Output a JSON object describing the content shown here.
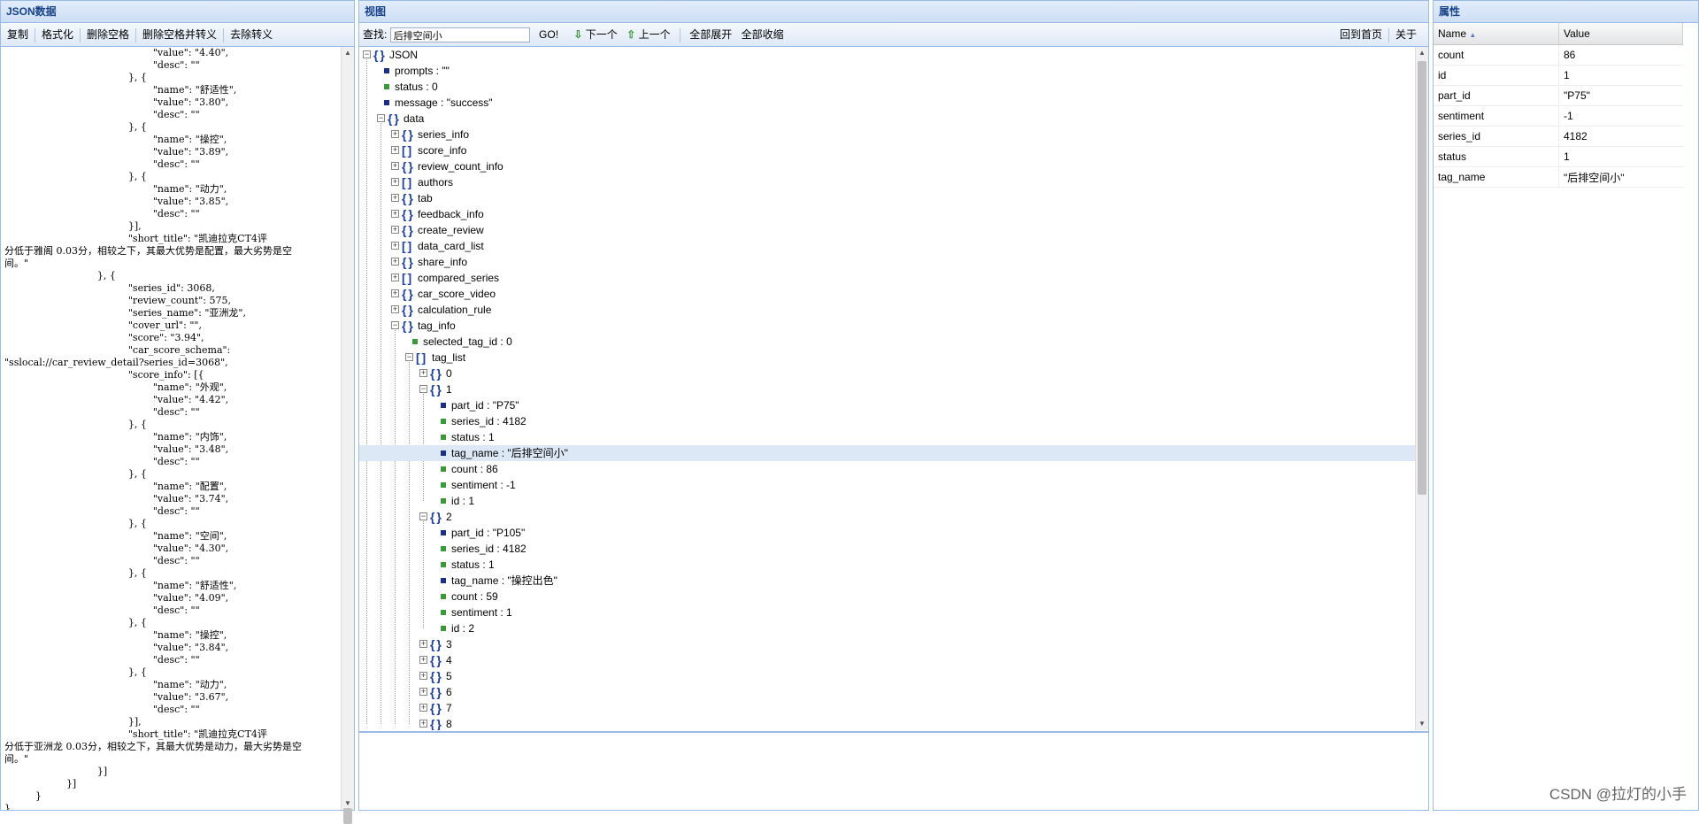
{
  "left": {
    "title": "JSON数据",
    "toolbar": [
      "复制",
      "格式化",
      "删除空格",
      "删除空格并转义",
      "去除转义"
    ],
    "lines": [
      "                                                \"value\": \"4.40\",",
      "                                                \"desc\": \"\"",
      "                                        }, {",
      "                                                \"name\": \"舒适性\",",
      "                                                \"value\": \"3.80\",",
      "                                                \"desc\": \"\"",
      "                                        }, {",
      "                                                \"name\": \"操控\",",
      "                                                \"value\": \"3.89\",",
      "                                                \"desc\": \"\"",
      "                                        }, {",
      "                                                \"name\": \"动力\",",
      "                                                \"value\": \"3.85\",",
      "                                                \"desc\": \"\"",
      "                                        }],",
      "                                        \"short_title\": \"凯迪拉克CT4评",
      "分低于雅阁 0.03分，相较之下，其最大优势是配置，最大劣势是空",
      "间。\"",
      "                              }, {",
      "                                        \"series_id\": 3068,",
      "                                        \"review_count\": 575,",
      "                                        \"series_name\": \"亚洲龙\",",
      "                                        \"cover_url\": \"\",",
      "                                        \"score\": \"3.94\",",
      "                                        \"car_score_schema\":",
      "\"sslocal://car_review_detail?series_id=3068\",",
      "                                        \"score_info\": [{",
      "                                                \"name\": \"外观\",",
      "                                                \"value\": \"4.42\",",
      "                                                \"desc\": \"\"",
      "                                        }, {",
      "                                                \"name\": \"内饰\",",
      "                                                \"value\": \"3.48\",",
      "                                                \"desc\": \"\"",
      "                                        }, {",
      "                                                \"name\": \"配置\",",
      "                                                \"value\": \"3.74\",",
      "                                                \"desc\": \"\"",
      "                                        }, {",
      "                                                \"name\": \"空间\",",
      "                                                \"value\": \"4.30\",",
      "                                                \"desc\": \"\"",
      "                                        }, {",
      "                                                \"name\": \"舒适性\",",
      "                                                \"value\": \"4.09\",",
      "                                                \"desc\": \"\"",
      "                                        }, {",
      "                                                \"name\": \"操控\",",
      "                                                \"value\": \"3.84\",",
      "                                                \"desc\": \"\"",
      "                                        }, {",
      "                                                \"name\": \"动力\",",
      "                                                \"value\": \"3.67\",",
      "                                                \"desc\": \"\"",
      "                                        }],",
      "                                        \"short_title\": \"凯迪拉克CT4评",
      "分低于亚洲龙 0.03分，相较之下，其最大优势是动力，最大劣势是空",
      "间。\"",
      "                              }]",
      "                    }]",
      "          }",
      "}"
    ]
  },
  "view": {
    "title": "视图",
    "search_label": "查找:",
    "search_value": "后排空间小",
    "go": "GO!",
    "next": "下一个",
    "prev": "上一个",
    "expand_all": "全部展开",
    "collapse_all": "全部收缩",
    "home": "回到首页",
    "about": "关于",
    "tree": [
      {
        "level": 0,
        "type": "obj",
        "label": "JSON",
        "state": "open"
      },
      {
        "level": 1,
        "type": "leaf",
        "label": "prompts : \"\"",
        "color": "b"
      },
      {
        "level": 1,
        "type": "leaf",
        "label": "status : 0",
        "color": "g"
      },
      {
        "level": 1,
        "type": "leaf",
        "label": "message : \"success\"",
        "color": "b"
      },
      {
        "level": 1,
        "type": "obj",
        "label": "data",
        "state": "open"
      },
      {
        "level": 2,
        "type": "obj",
        "label": "series_info",
        "state": "closed"
      },
      {
        "level": 2,
        "type": "arr",
        "label": "score_info",
        "state": "closed"
      },
      {
        "level": 2,
        "type": "obj",
        "label": "review_count_info",
        "state": "closed"
      },
      {
        "level": 2,
        "type": "arr",
        "label": "authors",
        "state": "closed"
      },
      {
        "level": 2,
        "type": "obj",
        "label": "tab",
        "state": "closed"
      },
      {
        "level": 2,
        "type": "obj",
        "label": "feedback_info",
        "state": "closed"
      },
      {
        "level": 2,
        "type": "obj",
        "label": "create_review",
        "state": "closed"
      },
      {
        "level": 2,
        "type": "arr",
        "label": "data_card_list",
        "state": "closed"
      },
      {
        "level": 2,
        "type": "obj",
        "label": "share_info",
        "state": "closed"
      },
      {
        "level": 2,
        "type": "arr",
        "label": "compared_series",
        "state": "closed"
      },
      {
        "level": 2,
        "type": "obj",
        "label": "car_score_video",
        "state": "closed"
      },
      {
        "level": 2,
        "type": "obj",
        "label": "calculation_rule",
        "state": "closed"
      },
      {
        "level": 2,
        "type": "obj",
        "label": "tag_info",
        "state": "open"
      },
      {
        "level": 3,
        "type": "leaf",
        "label": "selected_tag_id : 0",
        "color": "g"
      },
      {
        "level": 3,
        "type": "arr",
        "label": "tag_list",
        "state": "open"
      },
      {
        "level": 4,
        "type": "obj",
        "label": "0",
        "state": "closed"
      },
      {
        "level": 4,
        "type": "obj",
        "label": "1",
        "state": "open"
      },
      {
        "level": 5,
        "type": "leaf",
        "label": "part_id : \"P75\"",
        "color": "b"
      },
      {
        "level": 5,
        "type": "leaf",
        "label": "series_id : 4182",
        "color": "g"
      },
      {
        "level": 5,
        "type": "leaf",
        "label": "status : 1",
        "color": "g"
      },
      {
        "level": 5,
        "type": "leaf",
        "label": "tag_name : \"后排空间小\"",
        "color": "b",
        "selected": true
      },
      {
        "level": 5,
        "type": "leaf",
        "label": "count : 86",
        "color": "g"
      },
      {
        "level": 5,
        "type": "leaf",
        "label": "sentiment : -1",
        "color": "g"
      },
      {
        "level": 5,
        "type": "leaf",
        "label": "id : 1",
        "color": "g"
      },
      {
        "level": 4,
        "type": "obj",
        "label": "2",
        "state": "open"
      },
      {
        "level": 5,
        "type": "leaf",
        "label": "part_id : \"P105\"",
        "color": "b"
      },
      {
        "level": 5,
        "type": "leaf",
        "label": "series_id : 4182",
        "color": "g"
      },
      {
        "level": 5,
        "type": "leaf",
        "label": "status : 1",
        "color": "g"
      },
      {
        "level": 5,
        "type": "leaf",
        "label": "tag_name : \"操控出色\"",
        "color": "b"
      },
      {
        "level": 5,
        "type": "leaf",
        "label": "count : 59",
        "color": "g"
      },
      {
        "level": 5,
        "type": "leaf",
        "label": "sentiment : 1",
        "color": "g"
      },
      {
        "level": 5,
        "type": "leaf",
        "label": "id : 2",
        "color": "g"
      },
      {
        "level": 4,
        "type": "obj",
        "label": "3",
        "state": "closed"
      },
      {
        "level": 4,
        "type": "obj",
        "label": "4",
        "state": "closed"
      },
      {
        "level": 4,
        "type": "obj",
        "label": "5",
        "state": "closed"
      },
      {
        "level": 4,
        "type": "obj",
        "label": "6",
        "state": "closed"
      },
      {
        "level": 4,
        "type": "obj",
        "label": "7",
        "state": "closed"
      },
      {
        "level": 4,
        "type": "obj",
        "label": "8",
        "state": "closed"
      }
    ]
  },
  "props": {
    "title": "属性",
    "col_name": "Name",
    "col_value": "Value",
    "sort_icon": "sort-asc-icon",
    "rows": [
      {
        "name": "count",
        "value": "86"
      },
      {
        "name": "id",
        "value": "1"
      },
      {
        "name": "part_id",
        "value": "\"P75\""
      },
      {
        "name": "sentiment",
        "value": "-1"
      },
      {
        "name": "series_id",
        "value": "4182"
      },
      {
        "name": "status",
        "value": "1"
      },
      {
        "name": "tag_name",
        "value": "\"后排空间小\""
      }
    ]
  },
  "watermark": "CSDN @拉灯的小手",
  "colors": {
    "accent": "#15428b",
    "panel_border": "#99bbe8",
    "selected_row": "#dde8f6",
    "leaf_string": "#1a2e8a",
    "leaf_number": "#3a9a3a"
  }
}
